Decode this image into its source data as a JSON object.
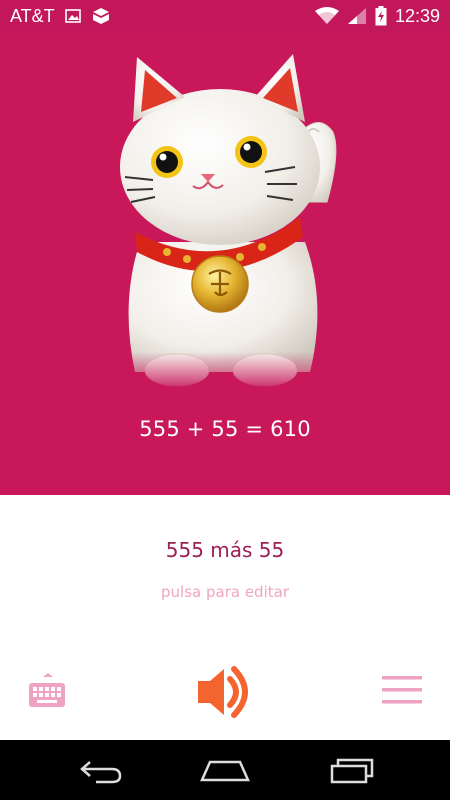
{
  "status_bar": {
    "carrier": "AT&T",
    "time": "12:39",
    "icons": [
      "image-icon",
      "dropbox-icon",
      "wifi-icon",
      "signal-icon",
      "battery-charging-icon"
    ]
  },
  "hero": {
    "image": "lucky-cat-image",
    "equation": "555 + 55 = 610"
  },
  "content": {
    "phrase": "555 más 55",
    "hint": "pulsa para editar"
  },
  "actions": {
    "keyboard_icon": "keyboard-icon",
    "speaker_icon": "speaker-icon",
    "menu_icon": "menu-icon"
  },
  "colors": {
    "primary": "#c8185a",
    "phrase": "#9c1f55",
    "hint": "#eea6c3",
    "accent_orange": "#f4642e",
    "icon_pink": "#efa2c1"
  },
  "nav": {
    "buttons": [
      "back-icon",
      "home-icon",
      "recent-apps-icon"
    ]
  }
}
